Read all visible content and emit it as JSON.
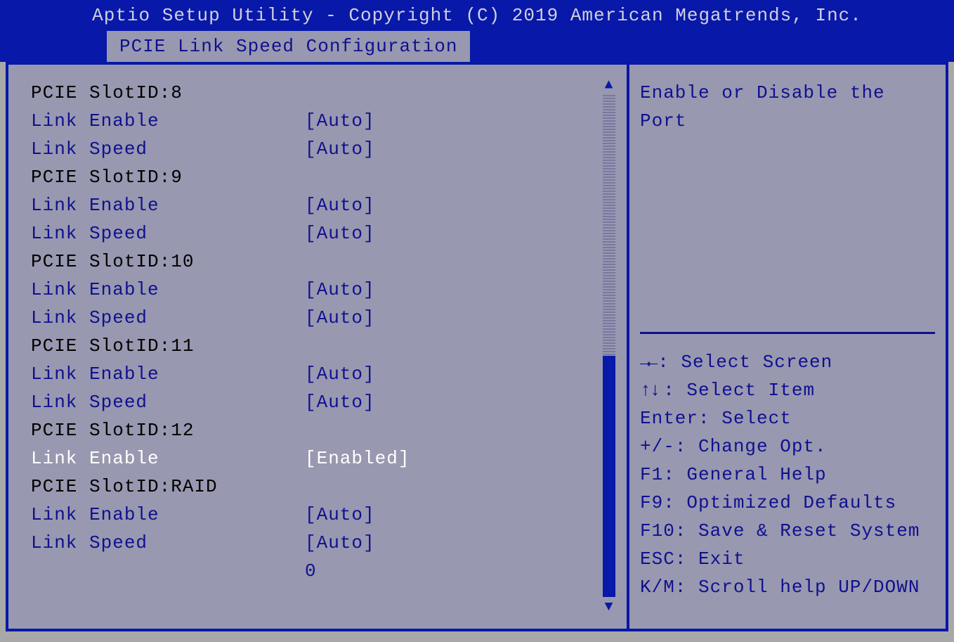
{
  "title": "Aptio Setup Utility - Copyright (C) 2019 American Megatrends, Inc.",
  "tab": "PCIE Link Speed Configuration",
  "rows": [
    {
      "type": "header",
      "label": "PCIE SlotID:8",
      "value": ""
    },
    {
      "type": "option",
      "label": "Link Enable",
      "value": "[Auto]"
    },
    {
      "type": "option",
      "label": "Link Speed",
      "value": "[Auto]"
    },
    {
      "type": "header",
      "label": "PCIE SlotID:9",
      "value": ""
    },
    {
      "type": "option",
      "label": "Link Enable",
      "value": "[Auto]"
    },
    {
      "type": "option",
      "label": "Link Speed",
      "value": "[Auto]"
    },
    {
      "type": "header",
      "label": "PCIE SlotID:10",
      "value": ""
    },
    {
      "type": "option",
      "label": "Link Enable",
      "value": "[Auto]"
    },
    {
      "type": "option",
      "label": "Link Speed",
      "value": "[Auto]"
    },
    {
      "type": "header",
      "label": "PCIE SlotID:11",
      "value": ""
    },
    {
      "type": "option",
      "label": "Link Enable",
      "value": "[Auto]"
    },
    {
      "type": "option",
      "label": "Link Speed",
      "value": "[Auto]"
    },
    {
      "type": "header",
      "label": "PCIE SlotID:12",
      "value": ""
    },
    {
      "type": "selected",
      "label": "Link Enable",
      "value": "[Enabled]"
    },
    {
      "type": "header",
      "label": "PCIE SlotID:RAID",
      "value": ""
    },
    {
      "type": "option",
      "label": "Link Enable",
      "value": "[Auto]"
    },
    {
      "type": "option",
      "label": "Link Speed",
      "value": "[Auto]"
    },
    {
      "type": "option",
      "label": "",
      "value": "0"
    }
  ],
  "help": {
    "line1": "Enable or Disable the",
    "line2": "Port"
  },
  "legend": {
    "select_screen": ": Select Screen",
    "select_item": ": Select Item",
    "enter": "Enter: Select",
    "change": "+/-: Change Opt.",
    "f1": "F1: General Help",
    "f9": "F9: Optimized Defaults",
    "f10": "F10: Save & Reset System",
    "esc": "ESC: Exit",
    "km": "K/M: Scroll help UP/DOWN"
  },
  "scroll": {
    "thumb_top_pct": 52,
    "thumb_height_pct": 48
  }
}
